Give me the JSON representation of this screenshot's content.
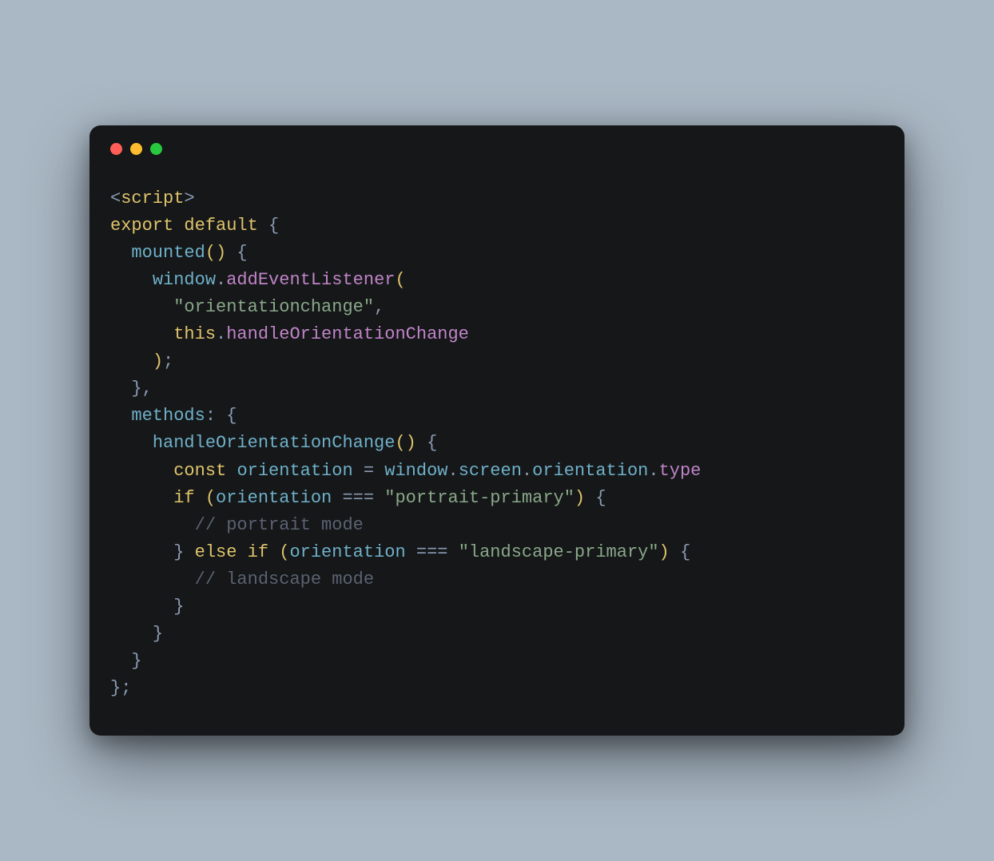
{
  "window": {
    "traffic_lights": [
      "close",
      "minimize",
      "zoom"
    ]
  },
  "code": {
    "indent": "  ",
    "tokens": [
      [
        {
          "t": "<",
          "c": "angle"
        },
        {
          "t": "script",
          "c": "tag"
        },
        {
          "t": ">",
          "c": "angle"
        }
      ],
      [
        {
          "t": "export ",
          "c": "kw"
        },
        {
          "t": "default ",
          "c": "kw"
        },
        {
          "t": "{",
          "c": "punct"
        }
      ],
      [
        {
          "t": "  ",
          "c": "plain"
        },
        {
          "t": "mounted",
          "c": "prop"
        },
        {
          "t": "()",
          "c": "paren"
        },
        {
          "t": " {",
          "c": "punct"
        }
      ],
      [
        {
          "t": "    ",
          "c": "plain"
        },
        {
          "t": "window",
          "c": "ident"
        },
        {
          "t": ".",
          "c": "punct"
        },
        {
          "t": "addEventListener",
          "c": "call"
        },
        {
          "t": "(",
          "c": "paren"
        }
      ],
      [
        {
          "t": "      ",
          "c": "plain"
        },
        {
          "t": "\"orientationchange\"",
          "c": "str"
        },
        {
          "t": ",",
          "c": "punct"
        }
      ],
      [
        {
          "t": "      ",
          "c": "plain"
        },
        {
          "t": "this",
          "c": "this"
        },
        {
          "t": ".",
          "c": "punct"
        },
        {
          "t": "handleOrientationChange",
          "c": "call"
        }
      ],
      [
        {
          "t": "    ",
          "c": "plain"
        },
        {
          "t": ")",
          "c": "paren"
        },
        {
          "t": ";",
          "c": "punct"
        }
      ],
      [
        {
          "t": "  ",
          "c": "plain"
        },
        {
          "t": "}",
          "c": "punct"
        },
        {
          "t": ",",
          "c": "punct"
        }
      ],
      [
        {
          "t": "  ",
          "c": "plain"
        },
        {
          "t": "methods",
          "c": "prop"
        },
        {
          "t": ": ",
          "c": "punct"
        },
        {
          "t": "{",
          "c": "punct"
        }
      ],
      [
        {
          "t": "    ",
          "c": "plain"
        },
        {
          "t": "handleOrientationChange",
          "c": "prop"
        },
        {
          "t": "()",
          "c": "paren"
        },
        {
          "t": " {",
          "c": "punct"
        }
      ],
      [
        {
          "t": "      ",
          "c": "plain"
        },
        {
          "t": "const ",
          "c": "kw"
        },
        {
          "t": "orientation ",
          "c": "ident"
        },
        {
          "t": "= ",
          "c": "op"
        },
        {
          "t": "window",
          "c": "ident"
        },
        {
          "t": ".",
          "c": "punct"
        },
        {
          "t": "screen",
          "c": "ident"
        },
        {
          "t": ".",
          "c": "punct"
        },
        {
          "t": "orientation",
          "c": "ident"
        },
        {
          "t": ".",
          "c": "punct"
        },
        {
          "t": "type",
          "c": "call"
        }
      ],
      [
        {
          "t": "      ",
          "c": "plain"
        },
        {
          "t": "if ",
          "c": "kw"
        },
        {
          "t": "(",
          "c": "paren"
        },
        {
          "t": "orientation ",
          "c": "ident"
        },
        {
          "t": "=== ",
          "c": "op"
        },
        {
          "t": "\"portrait-primary\"",
          "c": "str"
        },
        {
          "t": ")",
          "c": "paren"
        },
        {
          "t": " {",
          "c": "punct"
        }
      ],
      [
        {
          "t": "        ",
          "c": "plain"
        },
        {
          "t": "// portrait mode",
          "c": "comment"
        }
      ],
      [
        {
          "t": "      ",
          "c": "plain"
        },
        {
          "t": "} ",
          "c": "punct"
        },
        {
          "t": "else if ",
          "c": "kw"
        },
        {
          "t": "(",
          "c": "paren"
        },
        {
          "t": "orientation ",
          "c": "ident"
        },
        {
          "t": "=== ",
          "c": "op"
        },
        {
          "t": "\"landscape-primary\"",
          "c": "str"
        },
        {
          "t": ")",
          "c": "paren"
        },
        {
          "t": " {",
          "c": "punct"
        }
      ],
      [
        {
          "t": "        ",
          "c": "plain"
        },
        {
          "t": "// landscape mode",
          "c": "comment"
        }
      ],
      [
        {
          "t": "      ",
          "c": "plain"
        },
        {
          "t": "}",
          "c": "punct"
        }
      ],
      [
        {
          "t": "    ",
          "c": "plain"
        },
        {
          "t": "}",
          "c": "punct"
        }
      ],
      [
        {
          "t": "  ",
          "c": "plain"
        },
        {
          "t": "}",
          "c": "punct"
        }
      ],
      [
        {
          "t": "}",
          "c": "punct"
        },
        {
          "t": ";",
          "c": "punct"
        }
      ]
    ]
  },
  "colors": {
    "bg_page": "#aab8c5",
    "bg_window": "#151718",
    "red": "#ff5f57",
    "yellow": "#febc2e",
    "green": "#28c840",
    "punct": "#8b9bb4",
    "tag_kw": "#e0c46c",
    "ident": "#6fb0c9",
    "call": "#c084c9",
    "string": "#8aa78a",
    "comment": "#5a6272"
  }
}
